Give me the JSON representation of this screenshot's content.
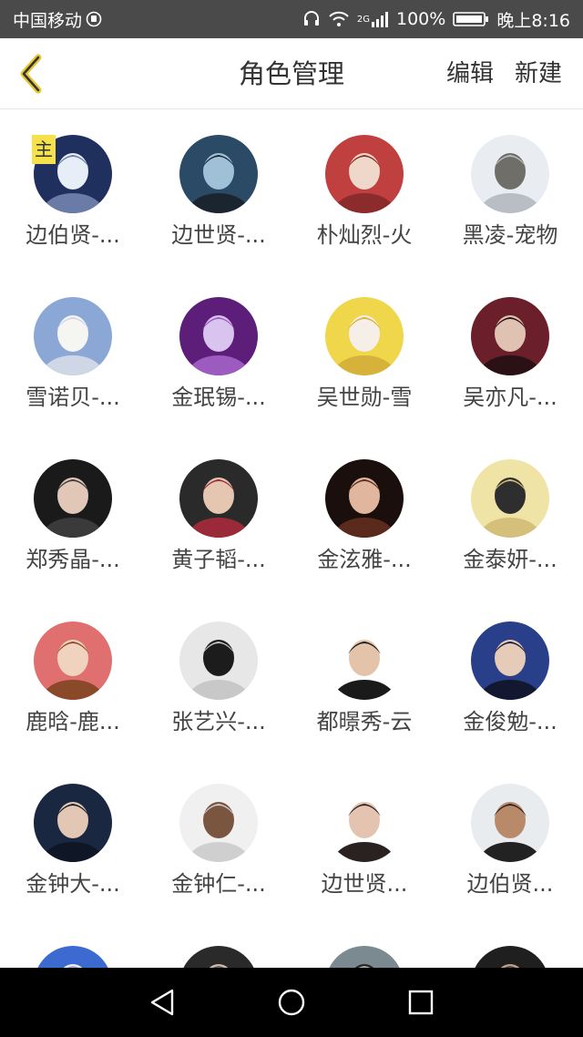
{
  "status_bar": {
    "carrier": "中国移动",
    "network": "2G",
    "battery": "100%",
    "time": "晚上8:16",
    "icons": [
      "headset-icon",
      "wifi-icon",
      "signal-icon",
      "battery-icon"
    ]
  },
  "header": {
    "title": "角色管理",
    "edit_label": "编辑",
    "new_label": "新建",
    "back_icon": "chevron-left-icon"
  },
  "accent_color": "#f6e04b",
  "roles": [
    {
      "name": "边伯贤-...",
      "badge": "主",
      "colors": [
        "#1f2f5e",
        "#e8eef7",
        "#6b7ba8"
      ]
    },
    {
      "name": "边世贤-...",
      "badge": "",
      "colors": [
        "#2b4a66",
        "#9ec1d8",
        "#1b2530"
      ]
    },
    {
      "name": "朴灿烈-火",
      "badge": "",
      "colors": [
        "#c04040",
        "#efd7c9",
        "#8b2b2b"
      ]
    },
    {
      "name": "黑凌-宠物",
      "badge": "",
      "colors": [
        "#e9edf2",
        "#6f6e68",
        "#b9bdc4"
      ]
    },
    {
      "name": "雪诺贝-...",
      "badge": "",
      "colors": [
        "#8aa7d6",
        "#f5f5f2",
        "#cfd6e6"
      ]
    },
    {
      "name": "金珉锡-...",
      "badge": "",
      "colors": [
        "#5d1e7a",
        "#d9c3ef",
        "#9b5bbf"
      ]
    },
    {
      "name": "吴世勋-雪",
      "badge": "",
      "colors": [
        "#f0d64a",
        "#f5efe8",
        "#d7b23a"
      ]
    },
    {
      "name": "吴亦凡-...",
      "badge": "",
      "colors": [
        "#6b1f2a",
        "#e0c2b3",
        "#2a1116"
      ]
    },
    {
      "name": "郑秀晶-...",
      "badge": "",
      "colors": [
        "#1a1a1a",
        "#e0c7b8",
        "#3a3a3a"
      ]
    },
    {
      "name": "黄子韬-...",
      "badge": "",
      "colors": [
        "#2a2a2a",
        "#e5c6b0",
        "#9a2a3a"
      ]
    },
    {
      "name": "金泫雅-...",
      "badge": "",
      "colors": [
        "#1a0f0c",
        "#e0b79e",
        "#5a2a1c"
      ]
    },
    {
      "name": "金泰妍-...",
      "badge": "",
      "colors": [
        "#f0e3a6",
        "#2e2e2e",
        "#d4c07a"
      ]
    },
    {
      "name": "鹿晗-鹿...",
      "badge": "",
      "colors": [
        "#e07070",
        "#f0d3bf",
        "#8a4a2a"
      ]
    },
    {
      "name": "张艺兴-...",
      "badge": "",
      "colors": [
        "#e7e7e7",
        "#1c1c1c",
        "#c8c8c8"
      ]
    },
    {
      "name": "都暻秀-云",
      "badge": "",
      "colors": [
        "#ffffff",
        "#e3c4aa",
        "#1a1a1a"
      ]
    },
    {
      "name": "金俊勉-...",
      "badge": "",
      "colors": [
        "#2a3f8a",
        "#e6cbb8",
        "#121830"
      ]
    },
    {
      "name": "金钟大-...",
      "badge": "",
      "colors": [
        "#1a2740",
        "#e2c7b5",
        "#0f1626"
      ]
    },
    {
      "name": "金钟仁-...",
      "badge": "",
      "colors": [
        "#f0f0f0",
        "#7a5540",
        "#cfcfcf"
      ]
    },
    {
      "name": "边世贤...",
      "badge": "",
      "colors": [
        "#ffffff",
        "#e4c4b0",
        "#2a2220"
      ]
    },
    {
      "name": "边伯贤...",
      "badge": "",
      "colors": [
        "#e9ecef",
        "#b98a6a",
        "#222222"
      ]
    },
    {
      "name": "",
      "badge": "",
      "colors": [
        "#3b6bd0",
        "#f0eaf0",
        "#9ab0de"
      ]
    },
    {
      "name": "",
      "badge": "",
      "colors": [
        "#2a2a2a",
        "#d8b9a4",
        "#5a5a5a"
      ]
    },
    {
      "name": "",
      "badge": "",
      "colors": [
        "#7a8a90",
        "#2a2220",
        "#aab4b8"
      ]
    },
    {
      "name": "",
      "badge": "",
      "colors": [
        "#1f1f1f",
        "#c4a089",
        "#4a4a4a"
      ]
    }
  ],
  "nav_bar": {
    "icons": [
      "back-triangle-icon",
      "home-circle-icon",
      "recents-square-icon"
    ]
  }
}
